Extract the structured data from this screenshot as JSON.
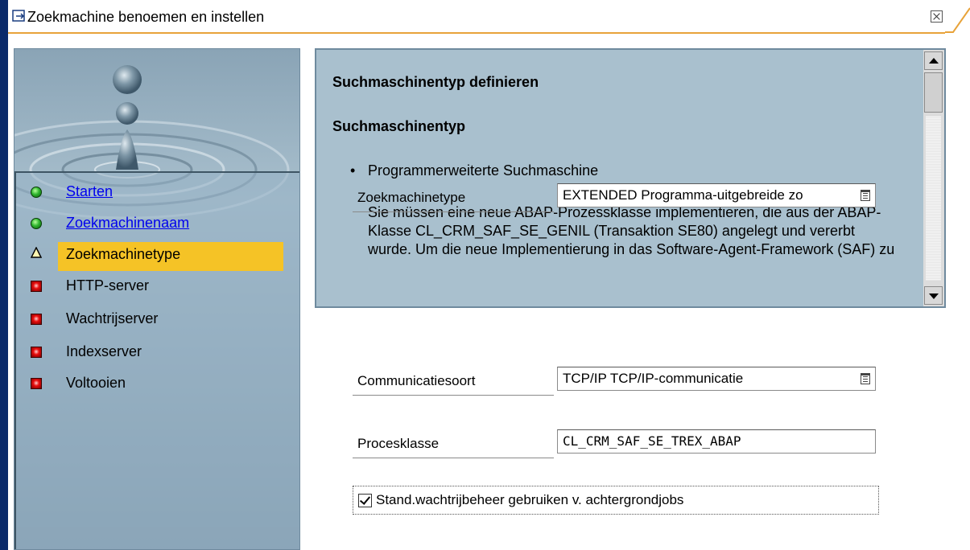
{
  "window": {
    "title": "Zoekmachine benoemen en instellen"
  },
  "nav": {
    "items": [
      {
        "label": "Starten",
        "status": "green",
        "type": "link"
      },
      {
        "label": "Zoekmachinenaam",
        "status": "green",
        "type": "link"
      },
      {
        "label": "Zoekmachinetype",
        "status": "warning",
        "type": "current"
      },
      {
        "label": "HTTP-server",
        "status": "red",
        "type": "plain"
      },
      {
        "label": "Wachtrijserver",
        "status": "red",
        "type": "plain"
      },
      {
        "label": "Indexserver",
        "status": "red",
        "type": "plain"
      },
      {
        "label": "Voltooien",
        "status": "red",
        "type": "plain"
      }
    ]
  },
  "info": {
    "heading": "Suchmaschinentyp definieren",
    "subheading": "Suchmaschinentyp",
    "bullet": "Programmerweiterte Suchmaschine",
    "paragraph": "Sie müssen eine neue ABAP-Prozessklasse implementieren, die aus der ABAP-Klasse CL_CRM_SAF_SE_GENIL (Transaktion SE80) angelegt und vererbt wurde. Um die neue Implementierung in das Software-Agent-Framework (SAF) zu"
  },
  "form": {
    "engine_type": {
      "label": "Zoekmachinetype",
      "value": "EXTENDED Programma-uitgebreide zo"
    },
    "comm_type": {
      "label": "Communicatiesoort",
      "value": "TCP/IP TCP/IP-communicatie"
    },
    "process_class": {
      "label": "Procesklasse",
      "value": "CL_CRM_SAF_SE_TREX_ABAP"
    },
    "queue_checkbox": {
      "label": "Stand.wachtrijbeheer gebruiken v. achtergrondjobs",
      "checked": true
    }
  },
  "colors": {
    "accent_bar": "#0a2a6a",
    "highlight": "#f5c326",
    "panel_bg": "#a9c0ce",
    "tab_underline": "#e8a33a"
  }
}
